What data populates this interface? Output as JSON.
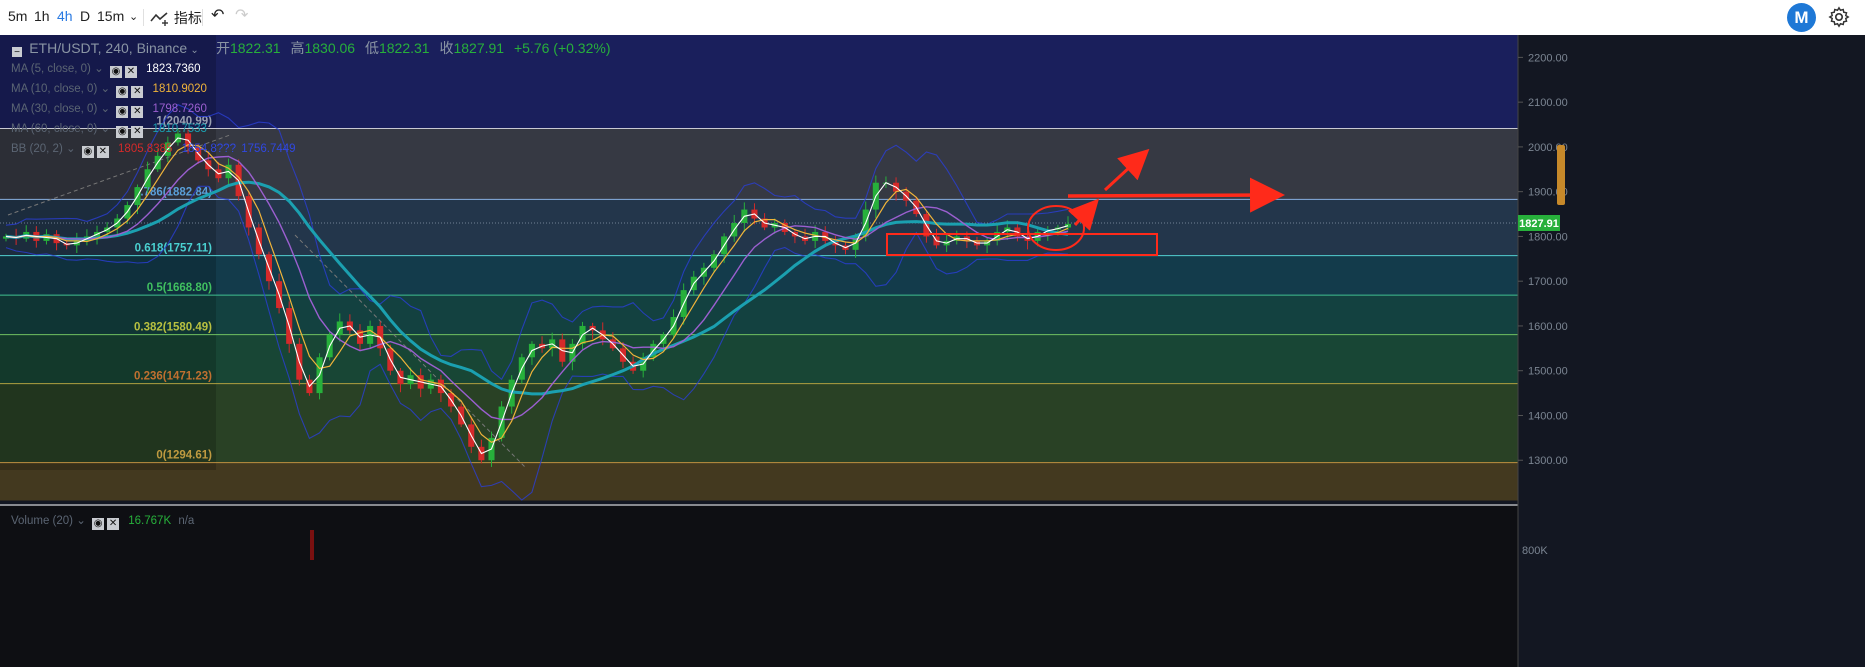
{
  "toolbar": {
    "intervals": [
      "5m",
      "1h",
      "4h",
      "D",
      "15m"
    ],
    "active_interval": "4h",
    "dropdown_icon": "chevron-down-icon",
    "indicators_label": "指标",
    "undo_icon": "undo-icon",
    "redo_icon": "redo-icon",
    "logo_letter": "M",
    "settings_icon": "gear-icon"
  },
  "legend": {
    "symbol": "ETH/USDT, 240, Binance",
    "ohlc": {
      "open_label": "开",
      "open": "1822.31",
      "high_label": "高",
      "high": "1830.06",
      "low_label": "低",
      "low": "1822.31",
      "close_label": "收",
      "close": "1827.91",
      "change": "+5.76 (+0.32%)"
    },
    "indicators": [
      {
        "name": "MA (5, close, 0)",
        "value": "1823.7360",
        "color": "#ffffff"
      },
      {
        "name": "MA (10, close, 0)",
        "value": "1810.9020",
        "color": "#f0b43a"
      },
      {
        "name": "MA (30, close, 0)",
        "value": "1798.7260",
        "color": "#9b5fd0"
      },
      {
        "name": "MA (60, close, 0)",
        "value": "1810.7533",
        "color": "#1ba0b0"
      }
    ],
    "bb": {
      "name": "BB (20, 2)",
      "v1": "1805.8385",
      "v2": "1854.8???",
      "v3": "1756.7449",
      "c1": "#d42a2a",
      "c2": "#2a3fd4",
      "c3": "#2a3fd4"
    },
    "volume": {
      "name": "Volume (20)",
      "value": "16.767K",
      "na": "n/a"
    }
  },
  "chart_data": {
    "type": "candlestick",
    "symbol": "ETH/USDT",
    "interval": "240",
    "exchange": "Binance",
    "ylim": [
      1200,
      2250
    ],
    "y_ticks": [
      "2200.00",
      "2100.00",
      "2000.00",
      "1900.00",
      "1800.00",
      "1700.00",
      "1600.00",
      "1500.00",
      "1400.00",
      "1300.00"
    ],
    "last_price": "1827.91",
    "volume_tick": "800K",
    "fib_levels": [
      {
        "label": "1(2040.99)",
        "value": 2040.99
      },
      {
        "label": "0.786(1882.84)",
        "value": 1882.84
      },
      {
        "label": "0.618(1757.11)",
        "value": 1757.11
      },
      {
        "label": "0.5(1668.80)",
        "value": 1668.8
      },
      {
        "label": "0.382(1580.49)",
        "value": 1580.49
      },
      {
        "label": "0.236(1471.23)",
        "value": 1471.23
      },
      {
        "label": "0(1294.61)",
        "value": 1294.61
      }
    ],
    "close_path": [
      1800,
      1795,
      1810,
      1790,
      1805,
      1785,
      1780,
      1790,
      1800,
      1810,
      1820,
      1840,
      1870,
      1910,
      1950,
      1980,
      2010,
      2030,
      2000,
      1970,
      1950,
      1930,
      1960,
      1890,
      1820,
      1760,
      1700,
      1640,
      1560,
      1480,
      1450,
      1530,
      1580,
      1610,
      1590,
      1560,
      1600,
      1550,
      1500,
      1470,
      1490,
      1460,
      1480,
      1450,
      1420,
      1380,
      1330,
      1300,
      1350,
      1420,
      1480,
      1530,
      1560,
      1550,
      1570,
      1520,
      1560,
      1600,
      1590,
      1570,
      1550,
      1520,
      1500,
      1530,
      1560,
      1580,
      1620,
      1680,
      1710,
      1730,
      1760,
      1800,
      1830,
      1860,
      1840,
      1820,
      1830,
      1810,
      1800,
      1790,
      1810,
      1790,
      1780,
      1770,
      1800,
      1860,
      1920,
      1920,
      1900,
      1880,
      1850,
      1800,
      1780,
      1790,
      1800,
      1790,
      1780,
      1790,
      1810,
      1820,
      1800,
      1790,
      1810,
      1815,
      1820,
      1828
    ],
    "annotations": {
      "rect_price_range": [
        1763,
        1805
      ],
      "circle_price": 1815,
      "arrows": [
        "up-right",
        "right"
      ]
    }
  }
}
